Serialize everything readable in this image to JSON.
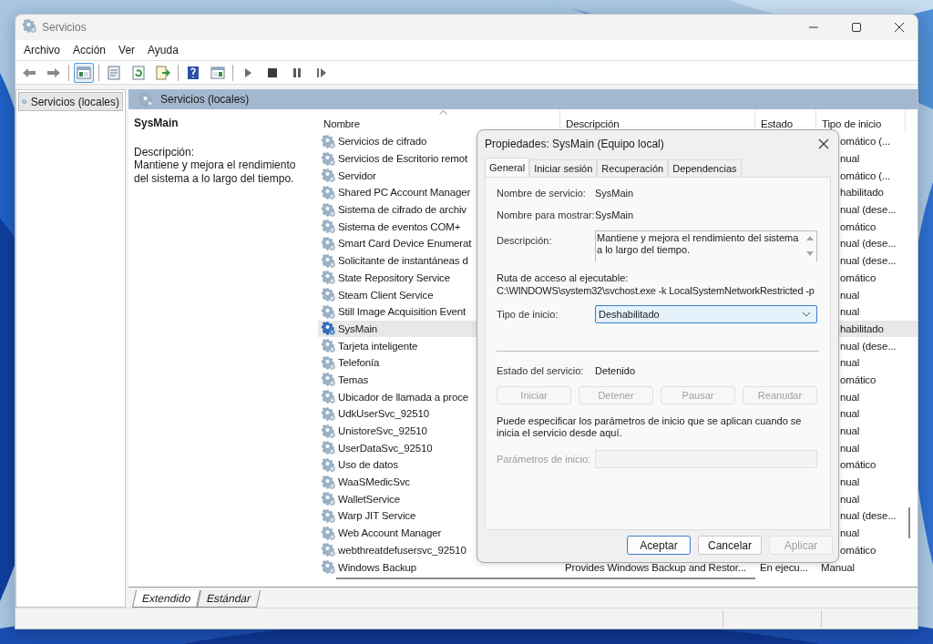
{
  "window": {
    "title": "Servicios"
  },
  "menu": [
    "Archivo",
    "Acción",
    "Ver",
    "Ayuda"
  ],
  "toolbar": [
    {
      "kind": "back",
      "selected": false
    },
    {
      "kind": "forward",
      "selected": false
    },
    {
      "kind": "separator"
    },
    {
      "kind": "console-tree",
      "selected": true
    },
    {
      "kind": "separator"
    },
    {
      "kind": "properties",
      "selected": false
    },
    {
      "kind": "refresh",
      "selected": false
    },
    {
      "kind": "export",
      "selected": false
    },
    {
      "kind": "separator"
    },
    {
      "kind": "help",
      "selected": false
    },
    {
      "kind": "action-pane",
      "selected": false
    },
    {
      "kind": "separator"
    },
    {
      "kind": "play",
      "selected": false
    },
    {
      "kind": "stop",
      "selected": false
    },
    {
      "kind": "pause",
      "selected": false
    },
    {
      "kind": "resume",
      "selected": false
    }
  ],
  "tree": {
    "items": [
      {
        "label": "Servicios (locales)",
        "selected": true
      }
    ]
  },
  "panel": {
    "title": "Servicios (locales)",
    "service_name": "SysMain",
    "description_label": "Descripción:",
    "description": "Mantiene y mejora el rendimiento del sistema a lo largo del tiempo."
  },
  "table": {
    "columns": [
      {
        "label": "Nombre",
        "sorted": true
      },
      {
        "label": "Descripción",
        "sorted": false
      },
      {
        "label": "Estado",
        "sorted": false
      },
      {
        "label": "Tipo de inicio",
        "sorted": false
      }
    ],
    "rows": [
      {
        "name": "Servicios de cifrado",
        "startup": "omático (...",
        "selected": false
      },
      {
        "name": "Servicios de Escritorio remot",
        "startup": "nual",
        "selected": false
      },
      {
        "name": "Servidor",
        "startup": "omático (...",
        "selected": false
      },
      {
        "name": "Shared PC Account Manager",
        "startup": "habilitado",
        "selected": false
      },
      {
        "name": "Sistema de cifrado de archiv",
        "startup": "nual (dese...",
        "selected": false
      },
      {
        "name": "Sistema de eventos COM+",
        "startup": "omático",
        "selected": false
      },
      {
        "name": "Smart Card Device Enumerat",
        "startup": "nual (dese...",
        "selected": false
      },
      {
        "name": "Solicitante de instantáneas d",
        "startup": "nual (dese...",
        "selected": false
      },
      {
        "name": "State Repository Service",
        "startup": "omático",
        "selected": false
      },
      {
        "name": "Steam Client Service",
        "startup": "nual",
        "selected": false
      },
      {
        "name": "Still Image Acquisition Event",
        "startup": "nual",
        "selected": false
      },
      {
        "name": "SysMain",
        "startup": "habilitado",
        "selected": true
      },
      {
        "name": "Tarjeta inteligente",
        "startup": "nual (dese...",
        "selected": false
      },
      {
        "name": "Telefonía",
        "startup": "nual",
        "selected": false
      },
      {
        "name": "Temas",
        "startup": "omático",
        "selected": false
      },
      {
        "name": "Ubicador de llamada a proce",
        "startup": "nual",
        "selected": false
      },
      {
        "name": "UdkUserSvc_92510",
        "startup": "nual",
        "selected": false
      },
      {
        "name": "UnistoreSvc_92510",
        "startup": "nual",
        "selected": false
      },
      {
        "name": "UserDataSvc_92510",
        "startup": "nual",
        "selected": false
      },
      {
        "name": "Uso de datos",
        "startup": "omático",
        "selected": false
      },
      {
        "name": "WaaSMedicSvc",
        "startup": "nual",
        "selected": false
      },
      {
        "name": "WalletService",
        "startup": "nual",
        "selected": false
      },
      {
        "name": "Warp JIT Service",
        "startup": "nual (dese...",
        "selected": false
      },
      {
        "name": "Web Account Manager",
        "startup": "nual",
        "selected": false
      },
      {
        "name": "webthreatdefusersvc_92510",
        "startup": "omático",
        "selected": false
      },
      {
        "name": "Windows Backup",
        "description": "Provides Windows Backup and Restor...",
        "status": "En ejecu...",
        "startup": "Manual",
        "selected": false
      }
    ]
  },
  "view_tabs": [
    {
      "label": "Extendido",
      "selected": true
    },
    {
      "label": "Estándar",
      "selected": false
    }
  ],
  "dialog": {
    "title": "Propiedades: SysMain (Equipo local)",
    "tabs": [
      {
        "label": "General",
        "selected": true
      },
      {
        "label": "Iniciar sesión",
        "selected": false
      },
      {
        "label": "Recuperación",
        "selected": false
      },
      {
        "label": "Dependencias",
        "selected": false
      }
    ],
    "service_name_label": "Nombre de servicio:",
    "service_name": "SysMain",
    "display_name_label": "Nombre para mostrar:",
    "display_name": "SysMain",
    "description_label": "Descripción:",
    "description": "Mantiene y mejora el rendimiento del sistema a lo largo del tiempo.",
    "path_label": "Ruta de acceso al ejecutable:",
    "path": "C:\\WINDOWS\\system32\\svchost.exe -k LocalSystemNetworkRestricted -p",
    "startup_label": "Tipo de inicio:",
    "startup_value": "Deshabilitado",
    "status_label": "Estado del servicio:",
    "status_value": "Detenido",
    "service_buttons": [
      {
        "label": "Iniciar",
        "disabled": true
      },
      {
        "label": "Detener",
        "disabled": true
      },
      {
        "label": "Pausar",
        "disabled": true
      },
      {
        "label": "Reanudar",
        "disabled": true
      }
    ],
    "note": "Puede especificar los parámetros de inicio que se aplican cuando se inicia el servicio desde aquí.",
    "params_label": "Parámetros de inicio:",
    "params_disabled": true,
    "buttons": [
      {
        "label": "Aceptar",
        "default": true,
        "disabled": false
      },
      {
        "label": "Cancelar",
        "default": false,
        "disabled": false
      },
      {
        "label": "Aplicar",
        "default": false,
        "disabled": true
      }
    ]
  }
}
